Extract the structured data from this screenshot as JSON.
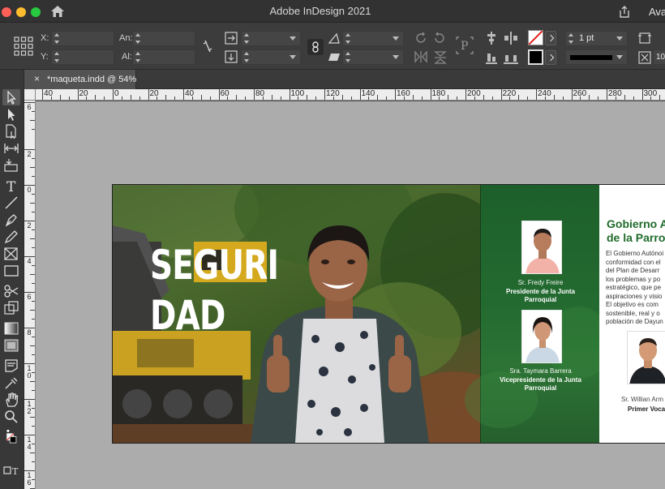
{
  "window": {
    "title": "Adobe InDesign 2021",
    "user_label": "Ava"
  },
  "control_bar": {
    "x_label": "X:",
    "y_label": "Y:",
    "width_label": "An:",
    "height_label": "Al:",
    "stroke_weight": "1 pt"
  },
  "tab": {
    "close": "×",
    "label": "*maqueta.indd @ 54%"
  },
  "ruler": {
    "horizontal": [
      "40",
      "20",
      "0",
      "20",
      "40",
      "60",
      "80",
      "100",
      "120",
      "140",
      "160",
      "180",
      "200",
      "220",
      "240",
      "260",
      "280",
      "300"
    ],
    "vertical": [
      "6",
      "2",
      "0",
      "2",
      "4",
      "6",
      "8",
      "10",
      "12",
      "14",
      "16"
    ]
  },
  "colors": {
    "accent_green": "#1f6b2b",
    "panel_green": "#236a30"
  },
  "document": {
    "headline_line1": "SEGURI",
    "headline_line2": "DAD",
    "members": [
      {
        "name": "Sr. Fredy Freire",
        "role_line1": "Presidente de la Junta",
        "role_line2": "Parroquial"
      },
      {
        "name": "Sra. Taymara Barrera",
        "role_line1": "Vicepresidente de la Junta",
        "role_line2": "Parroquial"
      }
    ],
    "right_page": {
      "title_line1": "Gobierno Autó",
      "title_line2": "de la Parroqu",
      "body_lines": [
        "El Gobierno Autónoi",
        "conformidad con el",
        "del  Plan de Desarr",
        "los problemas y po",
        "estratégico, que pe",
        "aspiraciones y visio",
        "El objetivo es com",
        "sostenible, real y o",
        "población de Dayun"
      ],
      "member_name": "Sr. Willian Arm",
      "member_role": "Primer Voca"
    }
  },
  "icons": [
    "home-icon",
    "share-icon",
    "reference-point-icon",
    "constrain-link-icon",
    "selection-tool-icon",
    "direct-selection-tool-icon",
    "page-tool-icon",
    "gap-tool-icon",
    "content-collector-icon",
    "type-tool-icon",
    "line-tool-icon",
    "pen-tool-icon",
    "pencil-tool-icon",
    "rectangle-frame-tool-icon",
    "rectangle-tool-icon",
    "scissors-tool-icon",
    "free-transform-tool-icon",
    "gradient-swatch-tool-icon",
    "gradient-feather-tool-icon",
    "note-tool-icon",
    "eyedropper-tool-icon",
    "hand-tool-icon",
    "zoom-tool-icon",
    "fill-stroke-swatch-icon"
  ]
}
